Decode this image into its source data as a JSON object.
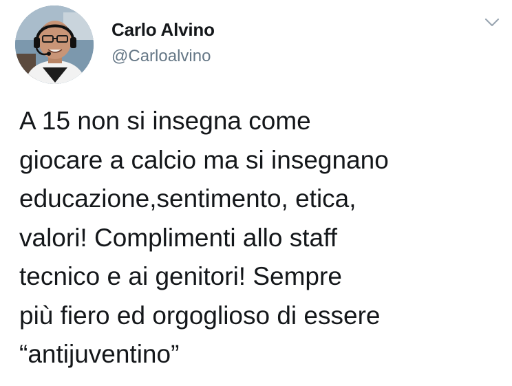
{
  "tweet": {
    "author": {
      "display_name": "Carlo Alvino",
      "handle": "@Carloalvino",
      "avatar_icon": "profile-photo"
    },
    "menu_icon": "chevron-down-icon",
    "text": "A 15 non si insegna come\ngiocare a calcio ma si insegnano\neducazione,sentimento, etica,\nvalori! Complimenti allo staff\ntecnico e ai genitori! Sempre\npiù fiero ed orgoglioso di essere\n“antijuventino”"
  },
  "colors": {
    "text_primary": "#14171a",
    "text_secondary": "#657786",
    "chevron": "#9aa6b2",
    "background": "#ffffff"
  }
}
